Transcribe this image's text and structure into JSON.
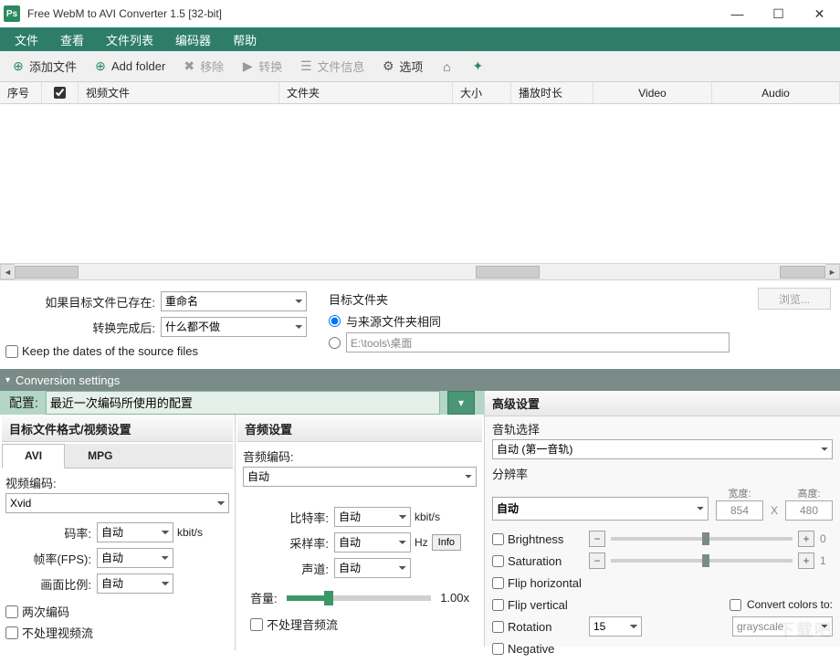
{
  "window": {
    "title": "Free WebM to AVI Converter 1.5  [32-bit]",
    "app_icon_text": "Ps"
  },
  "menu": {
    "file": "文件",
    "view": "查看",
    "filelist": "文件列表",
    "encoder": "编码器",
    "help": "帮助"
  },
  "toolbar": {
    "add_file": "添加文件",
    "add_folder": "Add folder",
    "remove": "移除",
    "convert": "转换",
    "file_info": "文件信息",
    "options": "选项"
  },
  "columns": {
    "no": "序号",
    "video_file": "视频文件",
    "folder": "文件夹",
    "size": "大小",
    "duration": "播放时长",
    "video": "Video",
    "audio": "Audio"
  },
  "middle": {
    "if_exists_label": "如果目标文件已存在:",
    "if_exists_value": "重命名",
    "after_convert_label": "转换完成后:",
    "after_convert_value": "什么都不做",
    "keep_dates": "Keep the dates of the source files",
    "dest_folder_label": "目标文件夹",
    "same_as_source": "与来源文件夹相同",
    "custom_path": "E:\\tools\\桌面",
    "browse": "浏览..."
  },
  "conv_header": "Conversion settings",
  "config": {
    "label": "配置:",
    "value": "最近一次编码所使用的配置"
  },
  "video": {
    "section": "目标文件格式/视频设置",
    "tab_avi": "AVI",
    "tab_mpg": "MPG",
    "codec_label": "视频编码:",
    "codec_value": "Xvid",
    "bitrate_label": "码率:",
    "bitrate_value": "自动",
    "bitrate_unit": "kbit/s",
    "fps_label": "帧率(FPS):",
    "fps_value": "自动",
    "aspect_label": "画面比例:",
    "aspect_value": "自动",
    "two_pass": "两次编码",
    "no_process": "不处理视频流"
  },
  "audio": {
    "section": "音频设置",
    "codec_label": "音频编码:",
    "codec_value": "自动",
    "bitrate_label": "比特率:",
    "bitrate_value": "自动",
    "bitrate_unit": "kbit/s",
    "sample_label": "采样率:",
    "sample_value": "自动",
    "sample_unit": "Hz",
    "channel_label": "声道:",
    "channel_value": "自动",
    "info": "Info",
    "volume_label": "音量:",
    "volume_value": "1.00x",
    "no_process": "不处理音频流"
  },
  "adv": {
    "section": "高级设置",
    "track_label": "音轨选择",
    "track_value": "自动 (第一音轨)",
    "res_label": "分辨率",
    "res_value": "自动",
    "width_label": "宽度:",
    "width_value": "854",
    "x": "X",
    "height_label": "高度:",
    "height_value": "480",
    "brightness": "Brightness",
    "brightness_val": "0",
    "saturation": "Saturation",
    "saturation_val": "1",
    "flip_h": "Flip horizontal",
    "flip_v": "Flip vertical",
    "rotation": "Rotation",
    "rotation_value": "15",
    "convert_colors": "Convert colors to:",
    "convert_colors_value": "grayscale",
    "negative": "Negative"
  }
}
